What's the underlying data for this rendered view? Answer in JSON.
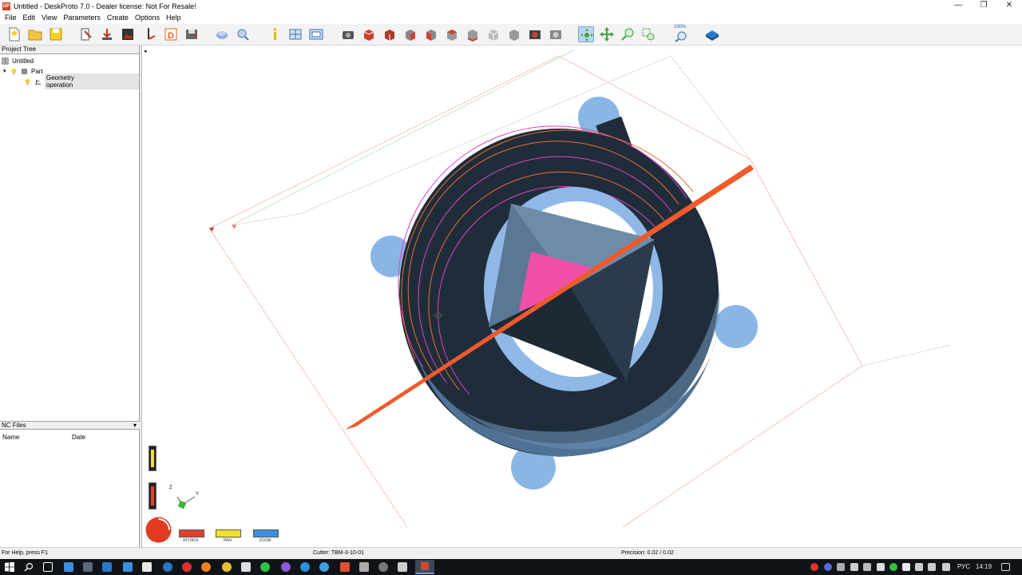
{
  "window": {
    "title": "Untitled - DeskProto 7.0 - Dealer license: Not For Resale!",
    "app_icon_text": "DP",
    "controls": [
      "—",
      "❐",
      "✕"
    ]
  },
  "menu": [
    "File",
    "Edit",
    "View",
    "Parameters",
    "Create",
    "Options",
    "Help"
  ],
  "toolbar": {
    "zoom_label": "100%"
  },
  "project_tree": {
    "header": "Project Tree",
    "root": "Untitled",
    "part": "Part",
    "operation": "Geometry operation"
  },
  "nc_files": {
    "header": "NC Files",
    "columns": [
      "Name",
      "Date"
    ]
  },
  "view_controls": {
    "rotate": "ROTATE",
    "pan": "PAN",
    "zoom": "ZOOM",
    "axis_z": "Z",
    "axis_y": "Y"
  },
  "status": {
    "help": "For Help, press F1",
    "cutter": "Cutter: TBM-3-10-01",
    "precision": "Precision: 0.02 / 0.02"
  },
  "taskbar": {
    "lang": "РУС",
    "time": "14:19"
  },
  "colors": {
    "model_dark": "#1f2d3a",
    "model_light": "#8fb8e6",
    "toolpath_orange": "#f05a2a",
    "toolpath_magenta": "#e040c0",
    "highlight_face": "#f050a8"
  }
}
